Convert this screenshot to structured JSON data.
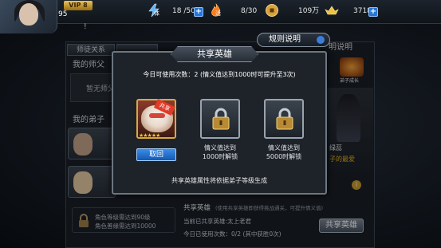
{
  "player": {
    "vip_label": "VIP 8",
    "level": "95"
  },
  "resources": {
    "stamina": "18 /50",
    "energy": "8/30",
    "copper": "109万",
    "gold": "3718"
  },
  "icon_text": {
    "stamina": "体",
    "energy": "活"
  },
  "background": {
    "tab_master_relation": "师徒关系",
    "tab_second": "",
    "my_master_heading": "我的师父",
    "no_master": "暂无师父",
    "my_disciples_heading": "我的弟子",
    "disciple_rank_1": "",
    "disciple_rank_2": "",
    "unlock_lines": [
      "角色等级需达到90级",
      "角色善缘需达到10000"
    ],
    "right_label": "明说明",
    "disciple_grow_label": "弟子成长",
    "hero_name_partial": "绿蕊",
    "hero_sub_partial": "子的最爱",
    "share_hero_label": "共享英雄",
    "share_hero_desc": "(使用共享英雄即获得挑战通关，可提升情义值)",
    "current_share_hero": "当前已共享英雄:太上老君",
    "today_uses": "今日已使用次数：0/2 (其中获胜0次)",
    "share_btn": "共享英雄"
  },
  "rules_button": "规则说明",
  "modal": {
    "title": "共享英雄",
    "uses_line": "今日可使用次数：2 (情义值达到1000时可提升至3次)",
    "slot1": {
      "badge": "共享",
      "stars": "★★★★★",
      "button": "取回"
    },
    "slot2": {
      "caption_1": "情义值达到",
      "caption_2": "1000时解锁"
    },
    "slot3": {
      "caption_1": "情义值达到",
      "caption_2": "5000时解锁"
    },
    "footer": "共享英雄属性将依据弟子等级生成"
  },
  "colors": {
    "accent_blue": "#2677d6",
    "gold": "#f0c23a",
    "panel_bg": "#1e2329"
  }
}
